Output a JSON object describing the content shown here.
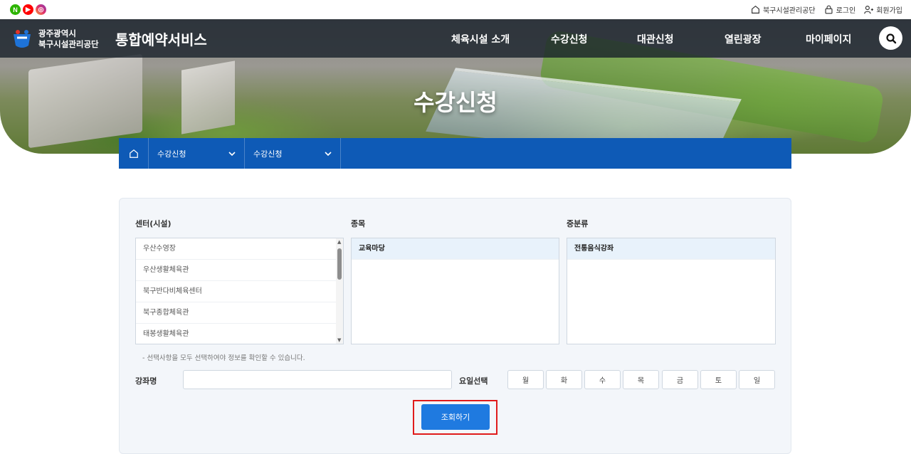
{
  "topbar": {
    "sns": [
      {
        "name": "naver-icon",
        "glyph": "N"
      },
      {
        "name": "youtube-icon",
        "glyph": "▶"
      },
      {
        "name": "instagram-icon",
        "glyph": "◎"
      }
    ],
    "links": [
      {
        "label": "북구시설관리공단",
        "icon": "home-icon"
      },
      {
        "label": "로그인",
        "icon": "lock-icon"
      },
      {
        "label": "회원가입",
        "icon": "user-add-icon"
      }
    ]
  },
  "header": {
    "org_line1": "광주광역시",
    "org_line2": "북구시설관리공단",
    "service_title": "통합예약서비스",
    "nav": [
      "체육시설 소개",
      "수강신청",
      "대관신청",
      "열린광장",
      "마이페이지"
    ],
    "hero_title": "수강신청"
  },
  "breadcrumb": {
    "level1": "수강신청",
    "level2": "수강신청"
  },
  "form": {
    "center_header": "센터(시설)",
    "sport_header": "종목",
    "category_header": "중분류",
    "centers": [
      "우산수영장",
      "우산생활체육관",
      "북구반다비체육센터",
      "북구종합체육관",
      "태봉생활체육관"
    ],
    "sports": [
      "교육마당"
    ],
    "categories": [
      "전통음식강좌"
    ],
    "notice": "- 선택사항을 모두 선택하여야 정보를 확인할 수 있습니다.",
    "course_label": "강좌명",
    "course_value": "",
    "day_label": "요일선택",
    "days": [
      "월",
      "화",
      "수",
      "목",
      "금",
      "토",
      "일"
    ],
    "search_button": "조회하기"
  },
  "colors": {
    "primary": "#0e5ab6",
    "button": "#1f7ae0",
    "highlight": "#e01b1b"
  }
}
